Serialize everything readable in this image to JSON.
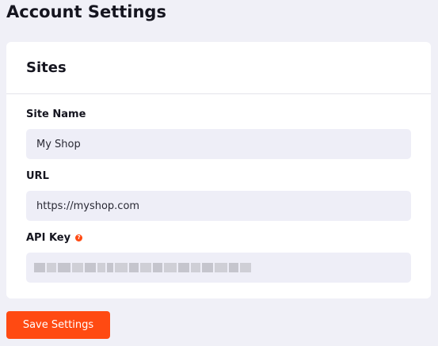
{
  "page": {
    "title": "Account Settings"
  },
  "sites_card": {
    "title": "Sites",
    "site_name": {
      "label": "Site Name",
      "value": "My Shop"
    },
    "url": {
      "label": "URL",
      "value": "https://myshop.com"
    },
    "api_key": {
      "label": "API Key",
      "help_icon": "question-circle-icon",
      "value_masked": true
    }
  },
  "actions": {
    "save_label": "Save Settings"
  },
  "colors": {
    "accent": "#ff4a12",
    "background": "#f0f0f7",
    "input_bg": "#eeeef7",
    "card_bg": "#ffffff"
  }
}
